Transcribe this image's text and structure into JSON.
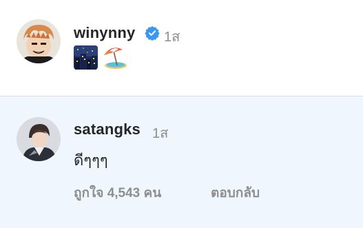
{
  "post": {
    "username": "winynny",
    "time": "1ส",
    "verified": true,
    "emojis": [
      "night-city-emoji",
      "beach-umbrella-emoji"
    ]
  },
  "reply": {
    "username": "satangks",
    "time": "1ส",
    "text": "ดีๆๆๆ",
    "likes_label": "ถูกใจ 4,543 คน",
    "reply_label": "ตอบกลับ"
  },
  "colors": {
    "verified_badge": "#3897f0",
    "muted_text": "#8e8e8e",
    "reply_background": "#eff6fe",
    "divider": "#dbdbdb"
  }
}
